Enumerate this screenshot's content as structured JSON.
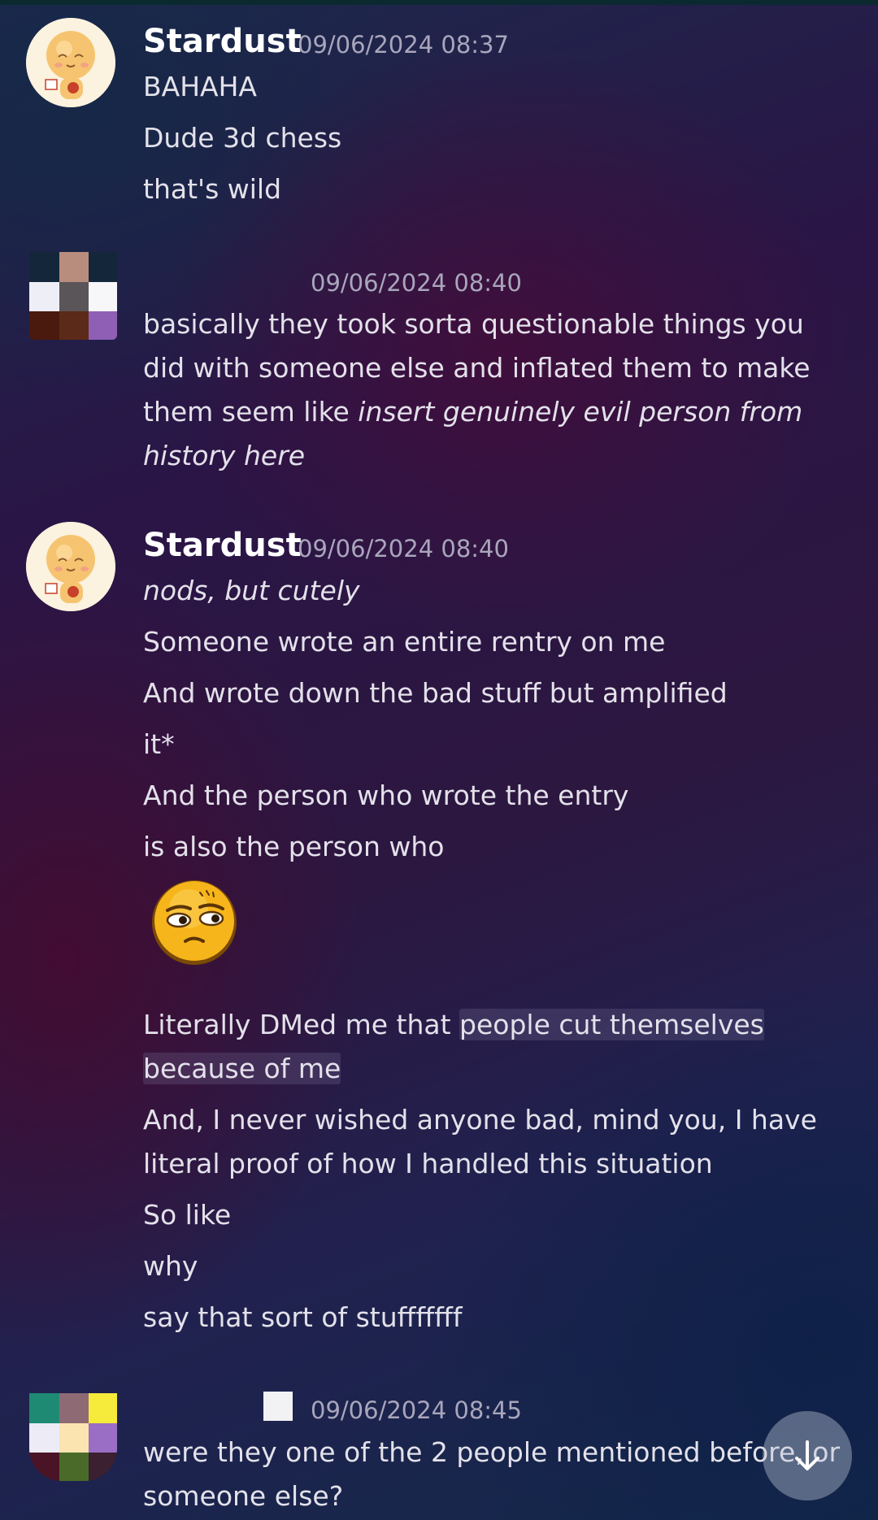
{
  "messages": [
    {
      "author": "Stardust",
      "timestamp": "09/06/2024 08:37",
      "avatar": "stardust-avatar",
      "lines": [
        "BAHAHA",
        "Dude 3d chess",
        "that's wild"
      ]
    },
    {
      "author": "",
      "timestamp": "09/06/2024 08:40",
      "avatar": "pixel-avatar",
      "lines": [
        {
          "plain": "basically they took sorta questionable things you did with someone else and inflated them to make them seem like ",
          "italic": "insert genuinely evil person from history here"
        }
      ]
    },
    {
      "author": "Stardust",
      "timestamp": "09/06/2024 08:40",
      "avatar": "stardust-avatar",
      "lines": [
        "nods, but cutely",
        "Someone wrote an entire rentry on me",
        "And wrote down the bad stuff but amplified",
        "it*",
        "And the person who wrote the entry",
        "is also the person who",
        "Literally DMed me that ",
        "people cut themselves",
        "because of me",
        "And, I never wished anyone bad, mind you, I have literal proof of how I handled this situation",
        "So like",
        "why",
        "say that sort of stufffffff"
      ],
      "emoji": "skeptical-face-emoji"
    },
    {
      "author": "",
      "timestamp": "09/06/2024 08:45",
      "avatar": "pixel-avatar",
      "lines": [
        "were they one of the 2 people mentioned before, or someone else?"
      ]
    }
  ],
  "scroll_button": {
    "icon": "arrow-down-icon"
  },
  "colors": {
    "username": "#ffffff",
    "timestamp": "#a9a6bc",
    "message_text": "#e3e1ea"
  }
}
